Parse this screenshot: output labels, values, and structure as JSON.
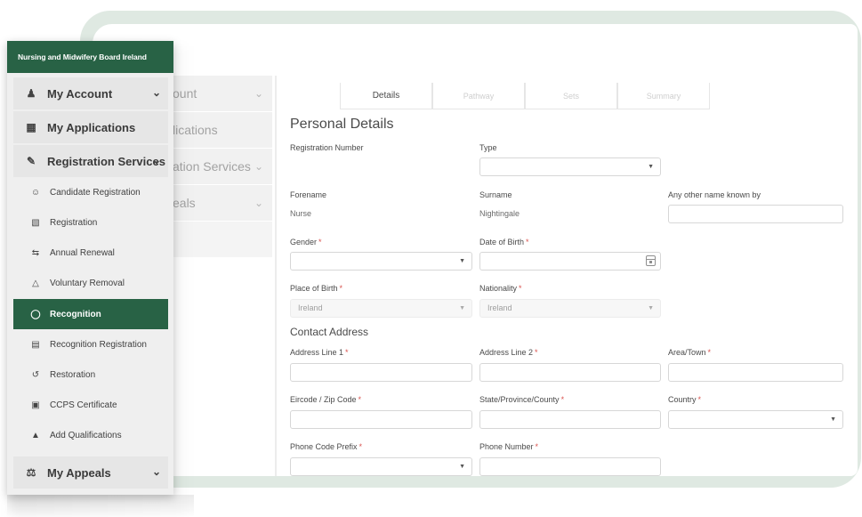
{
  "brand": "Nursing and Midwifery Board Ireland",
  "ghost_menu": [
    {
      "label": "ount",
      "chevron": true
    },
    {
      "label": "lications",
      "chevron": false
    },
    {
      "label": "ation Services",
      "chevron": true
    },
    {
      "label": "eals",
      "chevron": true
    },
    {
      "label": "",
      "chevron": false
    }
  ],
  "menu": {
    "my_account": "My Account",
    "my_applications": "My Applications",
    "registration_services": "Registration Services",
    "sub_items": [
      {
        "label": "Candidate Registration",
        "icon": "users-icon"
      },
      {
        "label": "Registration",
        "icon": "document-icon"
      },
      {
        "label": "Annual Renewal",
        "icon": "renew-icon"
      },
      {
        "label": "Voluntary Removal",
        "icon": "eraser-icon"
      },
      {
        "label": "Recognition",
        "icon": "badge-icon",
        "active": true
      },
      {
        "label": "Recognition Registration",
        "icon": "document-check-icon"
      },
      {
        "label": "Restoration",
        "icon": "undo-icon"
      },
      {
        "label": "CCPS Certificate",
        "icon": "certificate-icon"
      },
      {
        "label": "Add Qualifications",
        "icon": "graduation-icon"
      }
    ],
    "my_appeals": "My Appeals"
  },
  "tabs": [
    "Details",
    "Pathway",
    "Sets",
    "Summary"
  ],
  "form": {
    "title": "Personal Details",
    "registration_number_label": "Registration Number",
    "type_label": "Type",
    "forename_label": "Forename",
    "forename_value": "Nurse",
    "surname_label": "Surname",
    "surname_value": "Nightingale",
    "other_name_label": "Any other name known by",
    "gender_label": "Gender",
    "dob_label": "Date of Birth",
    "place_of_birth_label": "Place of Birth",
    "place_of_birth_value": "Ireland",
    "nationality_label": "Nationality",
    "nationality_value": "Ireland",
    "contact_title": "Contact Address",
    "address1_label": "Address Line 1",
    "address2_label": "Address Line 2",
    "area_label": "Area/Town",
    "eircode_label": "Eircode / Zip Code",
    "state_label": "State/Province/County",
    "country_label": "Country",
    "phone_prefix_label": "Phone Code Prefix",
    "phone_number_label": "Phone Number",
    "required_mark": "*",
    "caret": "▼"
  },
  "colors": {
    "brand_green": "#286245",
    "frame_green": "#dfe9e2",
    "required_red": "#d9534f"
  }
}
